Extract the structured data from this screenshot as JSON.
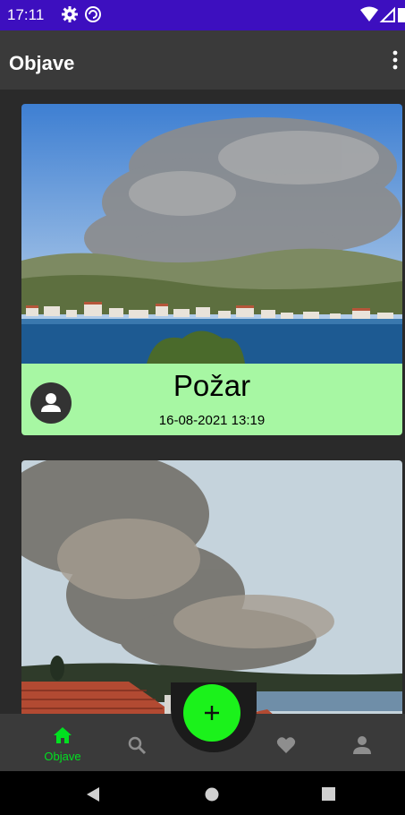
{
  "status_bar": {
    "time": "17:11",
    "icons": [
      "gear-icon",
      "sync-icon",
      "wifi-icon",
      "signal-icon",
      "battery-icon"
    ]
  },
  "app_bar": {
    "title": "Objave",
    "menu_icon": "more-vert-icon"
  },
  "feed": {
    "posts": [
      {
        "title": "Požar",
        "date": "16-08-2021 13:19",
        "image": "wildfire-smoke-over-coastal-town",
        "avatar_icon": "person-icon"
      },
      {
        "image": "wildfire-smoke-over-rooftops"
      }
    ]
  },
  "bottom_nav": {
    "items": [
      {
        "label": "Objave",
        "icon": "home-icon",
        "active": true
      },
      {
        "icon": "search-icon"
      },
      {
        "icon": "heart-icon"
      },
      {
        "icon": "person-icon"
      }
    ],
    "fab_icon": "plus-icon"
  },
  "system_nav": {
    "icons": [
      "back-icon",
      "home-circle-icon",
      "recents-icon"
    ]
  },
  "colors": {
    "status_bar": "#3d0fbf",
    "app_bar": "#3a3a3a",
    "accent": "#1bf21b",
    "card_footer": "#a7f7a3",
    "background": "#2a2a2a"
  }
}
